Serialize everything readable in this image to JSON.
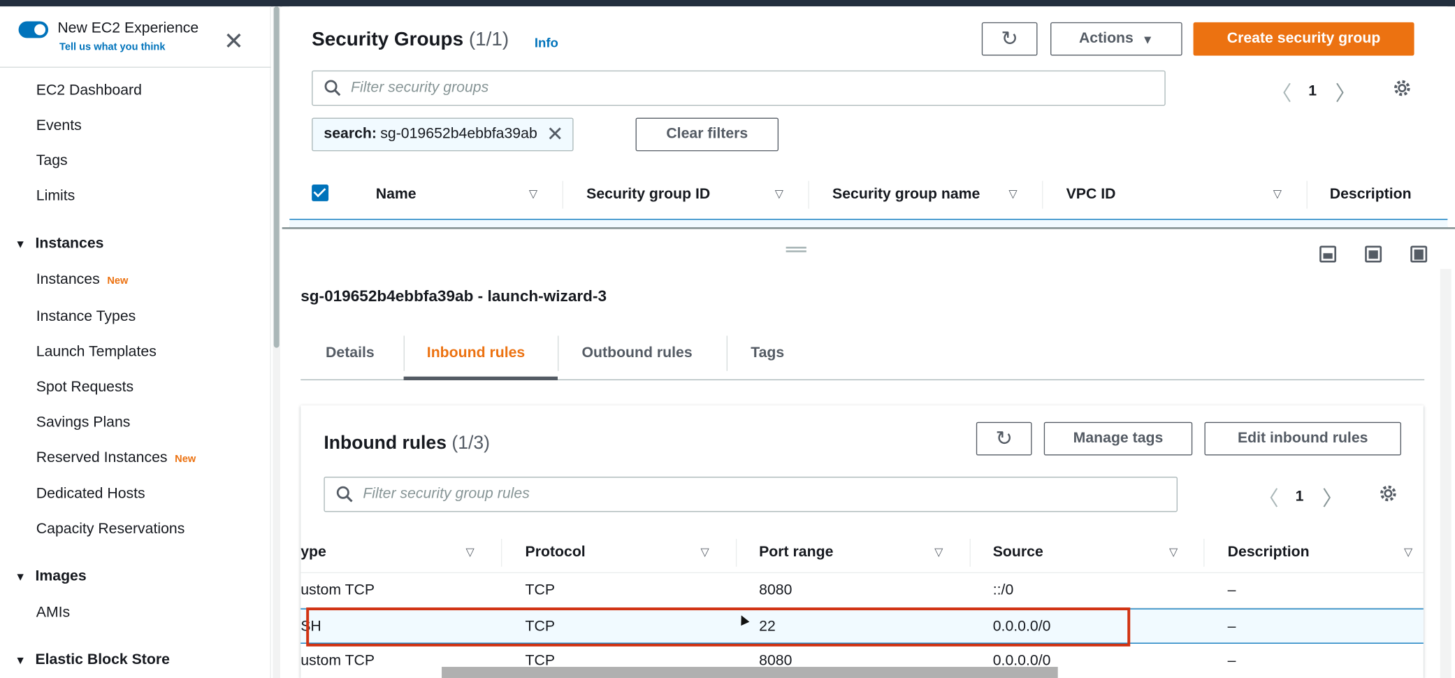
{
  "sidebar": {
    "experience_title": "New EC2 Experience",
    "experience_subtitle": "Tell us what you think",
    "items": [
      {
        "label": "EC2 Dashboard"
      },
      {
        "label": "Events"
      },
      {
        "label": "Tags"
      },
      {
        "label": "Limits"
      }
    ],
    "instances_section": "Instances",
    "instances_items": [
      {
        "label": "Instances",
        "badge": "New"
      },
      {
        "label": "Instance Types"
      },
      {
        "label": "Launch Templates"
      },
      {
        "label": "Spot Requests"
      },
      {
        "label": "Savings Plans"
      },
      {
        "label": "Reserved Instances",
        "badge": "New"
      },
      {
        "label": "Dedicated Hosts"
      },
      {
        "label": "Capacity Reservations"
      }
    ],
    "images_section": "Images",
    "images_items": [
      {
        "label": "AMIs"
      }
    ],
    "ebs_section": "Elastic Block Store"
  },
  "security_groups": {
    "title": "Security Groups",
    "count": "(1/1)",
    "info": "Info",
    "actions_label": "Actions",
    "create_label": "Create security group",
    "filter_placeholder": "Filter security groups",
    "page": "1",
    "filter_token_key": "search:",
    "filter_token_value": "sg-019652b4ebbfa39ab",
    "clear_filters": "Clear filters",
    "columns": [
      "Name",
      "Security group ID",
      "Security group name",
      "VPC ID",
      "Description"
    ]
  },
  "detail": {
    "title": "sg-019652b4ebbfa39ab - launch-wizard-3",
    "tabs": [
      "Details",
      "Inbound rules",
      "Outbound rules",
      "Tags"
    ],
    "active_tab": "Inbound rules"
  },
  "inbound": {
    "title": "Inbound rules",
    "count": "(1/3)",
    "manage_tags": "Manage tags",
    "edit_rules": "Edit inbound rules",
    "filter_placeholder": "Filter security group rules",
    "page": "1",
    "columns": [
      "ype",
      "Protocol",
      "Port range",
      "Source",
      "Description"
    ],
    "rows": [
      {
        "type": "ustom TCP",
        "protocol": "TCP",
        "port": "8080",
        "source": "::/0",
        "description": "–"
      },
      {
        "type": "SH",
        "protocol": "TCP",
        "port": "22",
        "source": "0.0.0.0/0",
        "description": "–"
      },
      {
        "type": "ustom TCP",
        "protocol": "TCP",
        "port": "8080",
        "source": "0.0.0.0/0",
        "description": "–"
      }
    ],
    "selected_row": 1
  },
  "colors": {
    "accent": "#ec7211",
    "link": "#0073bb",
    "highlight": "#d13212"
  }
}
